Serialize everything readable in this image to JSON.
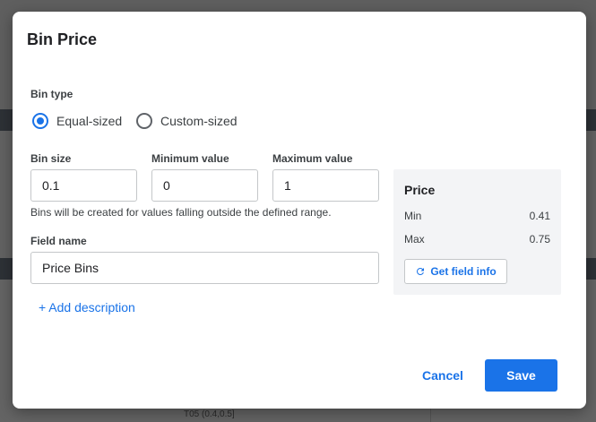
{
  "background": {
    "row_text": "T05 (0.4,0.5]"
  },
  "dialog": {
    "title": "Bin Price",
    "bin_type": {
      "label": "Bin type",
      "options": [
        {
          "label": "Equal-sized",
          "checked": true
        },
        {
          "label": "Custom-sized",
          "checked": false
        }
      ]
    },
    "bin_size": {
      "label": "Bin size",
      "value": "0.1"
    },
    "minimum_value": {
      "label": "Minimum value",
      "value": "0"
    },
    "maximum_value": {
      "label": "Maximum value",
      "value": "1"
    },
    "range_hint": "Bins will be created for values falling outside the defined range.",
    "field_name": {
      "label": "Field name",
      "value": "Price Bins"
    },
    "add_description": "+ Add description",
    "price_panel": {
      "title": "Price",
      "min_label": "Min",
      "min_value": "0.41",
      "max_label": "Max",
      "max_value": "0.75",
      "get_field_info": "Get field info"
    },
    "cancel_label": "Cancel",
    "save_label": "Save"
  },
  "colors": {
    "accent": "#1a73e8",
    "panel_bg": "#f3f4f6"
  }
}
